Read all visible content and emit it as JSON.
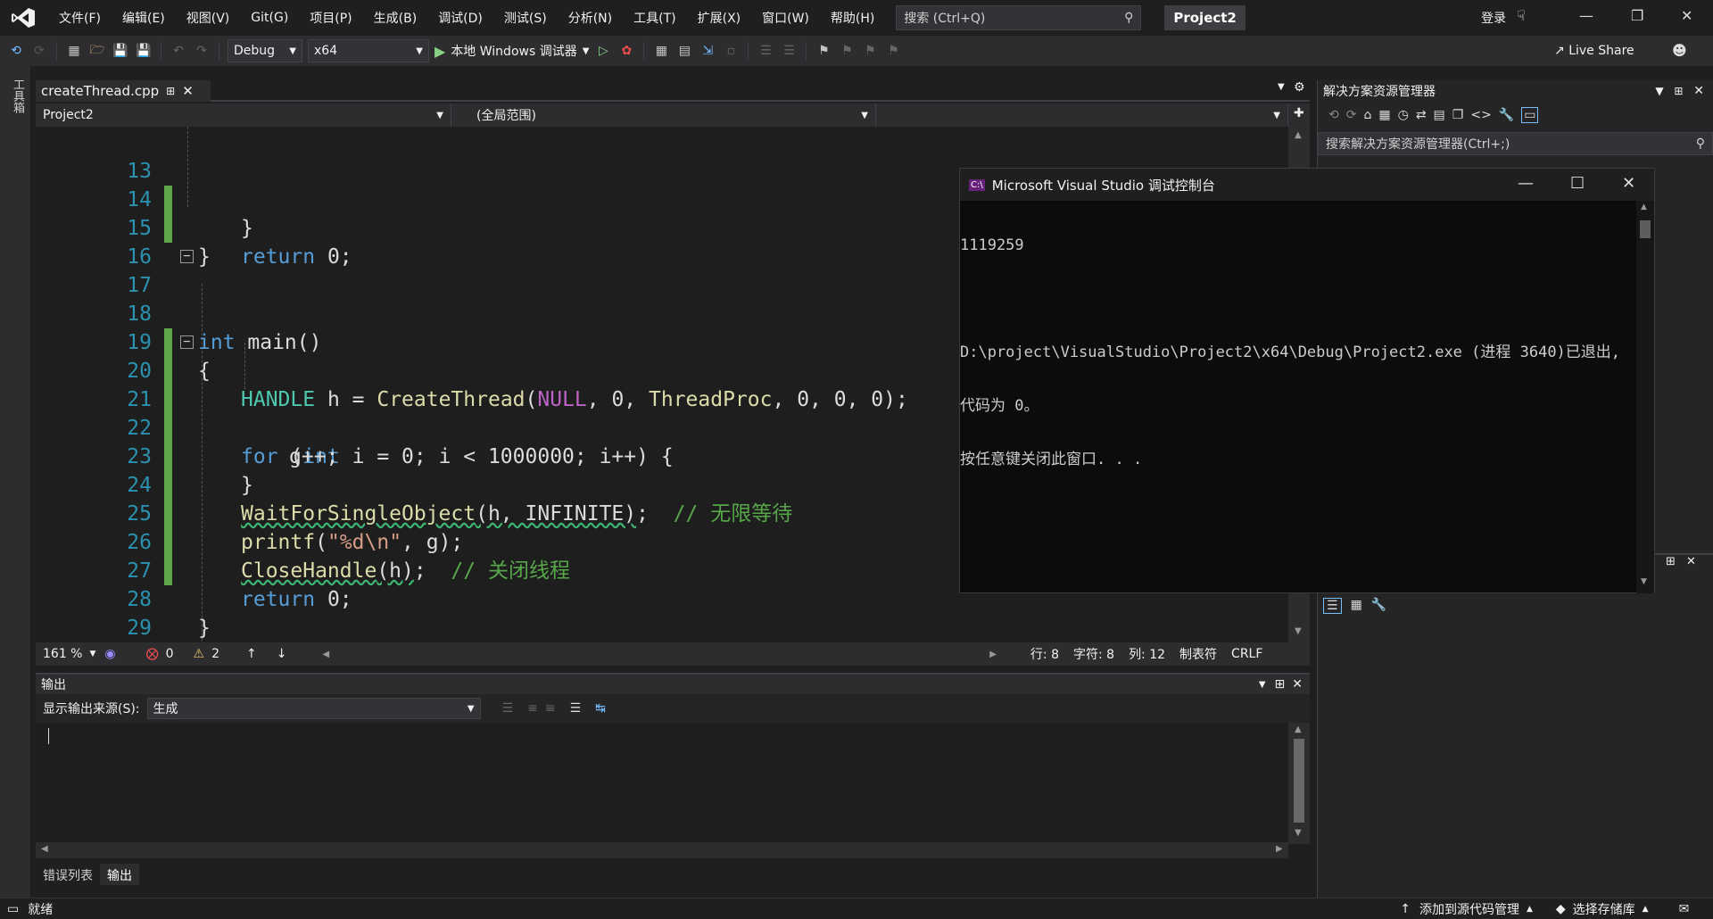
{
  "menu": {
    "items": [
      "文件(F)",
      "编辑(E)",
      "视图(V)",
      "Git(G)",
      "项目(P)",
      "生成(B)",
      "调试(D)",
      "测试(S)",
      "分析(N)",
      "工具(T)",
      "扩展(X)",
      "窗口(W)",
      "帮助(H)"
    ],
    "search_placeholder": "搜索 (Ctrl+Q)",
    "project_badge": "Project2",
    "login": "登录"
  },
  "toolbar": {
    "config": "Debug",
    "platform": "x64",
    "debugger": "本地 Windows 调试器",
    "liveshare": "Live Share"
  },
  "toolstrip_label": "工具箱",
  "editor": {
    "tab_name": "createThread.cpp",
    "nav_project": "Project2",
    "nav_scope": "(全局范围)",
    "lines": [
      {
        "n": "13"
      },
      {
        "n": "14"
      },
      {
        "n": "15"
      },
      {
        "n": "16"
      },
      {
        "n": "17"
      },
      {
        "n": "18"
      },
      {
        "n": "19"
      },
      {
        "n": "20"
      },
      {
        "n": "21"
      },
      {
        "n": "22"
      },
      {
        "n": "23"
      },
      {
        "n": "24"
      },
      {
        "n": "25"
      },
      {
        "n": "26"
      },
      {
        "n": "27"
      },
      {
        "n": "28"
      },
      {
        "n": "29"
      }
    ],
    "code": {
      "l13": "}",
      "l14_kw": "return",
      "l14_rest": " 0;",
      "l15": "}",
      "l17_kw": "int",
      "l17_rest": " main()",
      "l18": "{",
      "l19_type": "HANDLE",
      "l19_var": " h = ",
      "l19_fn": "CreateThread",
      "l19_open": "(",
      "l19_null": "NULL",
      "l19_a": ", 0, ",
      "l19_proc": "ThreadProc",
      "l19_b": ", 0, 0, 0);",
      "l20_kw": "for",
      "l20_a": " (",
      "l20_int": "int",
      "l20_b": " i = 0; i < 1000000; i++) {",
      "l21": "g++;",
      "l22": "}",
      "l23_fn": "WaitForSingleObject",
      "l23_args": "(h, INFINITE)",
      "l23_semi": ";  ",
      "l23_cm": "// 无限等待",
      "l24_fn": "printf",
      "l24_a": "(",
      "l24_str": "\"%d\\n\"",
      "l24_b": ", g);",
      "l25_fn": "CloseHandle",
      "l25_args": "(h)",
      "l25_semi": ";  ",
      "l25_cm": "// 关闭线程",
      "l27_kw": "return",
      "l27_rest": " 0;",
      "l28": "}"
    },
    "status": {
      "zoom": "161 %",
      "errors": "0",
      "warnings": "2",
      "row": "行: 8",
      "char": "字符: 8",
      "col": "列: 12",
      "tabs": "制表符",
      "eol": "CRLF"
    }
  },
  "output": {
    "title": "输出",
    "source_label": "显示输出来源(S):",
    "source_value": "生成"
  },
  "bottom_tabs": [
    "错误列表",
    "输出"
  ],
  "solution_explorer": {
    "title": "解决方案资源管理器",
    "search_placeholder": "搜索解决方案资源管理器(Ctrl+;)"
  },
  "console": {
    "title": "Microsoft Visual Studio 调试控制台",
    "lines": [
      "1119259",
      "",
      "D:\\project\\VisualStudio\\Project2\\x64\\Debug\\Project2.exe (进程 3640)已退出,",
      "代码为 0。",
      "按任意键关闭此窗口. . ."
    ]
  },
  "statusbar": {
    "ready": "就绪",
    "add_source_control": "添加到源代码管理",
    "select_repo": "选择存储库"
  }
}
